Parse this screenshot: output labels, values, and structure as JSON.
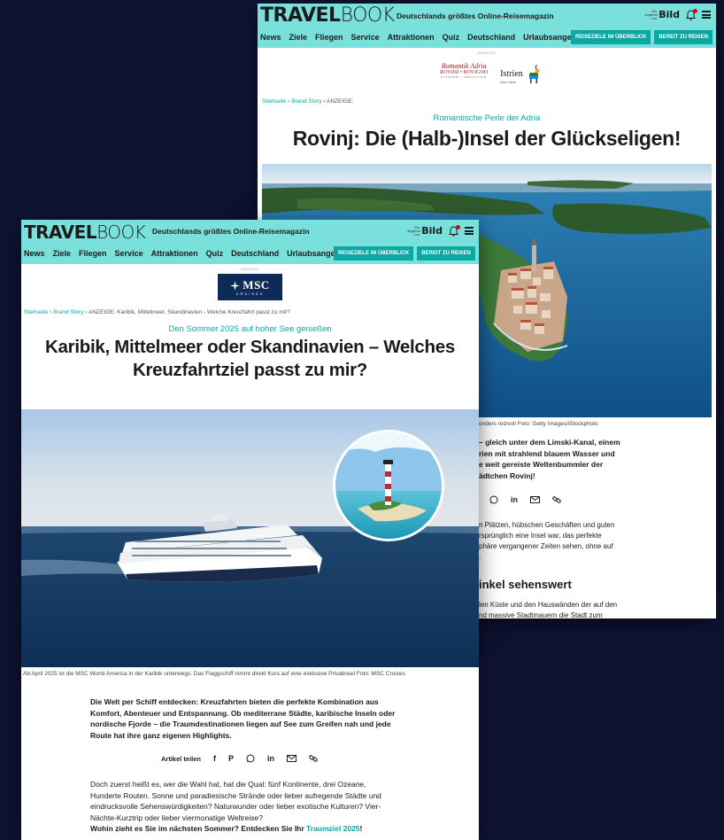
{
  "site": {
    "logo_bold": "TRAVEL",
    "logo_thin": "BOOK",
    "tagline": "Deutschlands größtes Online-Reisemagazin",
    "bild_mini": "Ein Angebot von",
    "bild_logo": "Bild",
    "nav": [
      "News",
      "Ziele",
      "Fliegen",
      "Service",
      "Attraktionen",
      "Quiz",
      "Deutschland",
      "Urlaubsangebote"
    ],
    "nav_buttons": [
      "REISEZIELE IM ÜBERBLICK",
      "BEREIT ZU REISEN"
    ],
    "ad_label": "ANZEIGE"
  },
  "back_article": {
    "ad_logo_script": "Romantik Adria",
    "ad_logo_name": "ROVINJ • ROVIGNO",
    "ad_logo_sub": "ISTRIEN • KROATIEN",
    "ad_logo_istrien": "Istrien",
    "ad_logo_istrien_sub": "Istra / Istria",
    "breadcrumb_home": "Startseite",
    "breadcrumb_section": "Brand Story",
    "breadcrumb_current": "ANZEIGE:",
    "kicker": "Romantische Perle der Adria",
    "title": "Rovinj: Die (Halb-)Insel der Glückseligen!",
    "caption": "onders reizvoll Foto: Getty Images/iStockphoto",
    "lead_lines": [
      "– gleich unter dem Limski-Kanal, einem",
      "rien mit strahlend blauem Wasser und",
      "e weit gereiste Weltenbummler der",
      "ädtchen Rovinj!"
    ],
    "body_lines": [
      "n Plätzen, hübschen Geschäften und guten",
      "rsprünglich eine Insel war, das perfekte",
      "phäre vergangener Zeiten sehen, ohne auf",
      "."
    ],
    "subheading": "inkel sehenswert",
    "body2_lines": [
      "len Küste und den Hauswänden der auf den",
      "nd massive Stadtmauern die Stadt zum"
    ]
  },
  "front_article": {
    "ad_logo": "MSC",
    "ad_logo_sub": "CRUISES",
    "breadcrumb_home": "Startseite",
    "breadcrumb_section": "Brand Story",
    "breadcrumb_current": "ANZEIGE: Karibik, Mittelmeer, Skandinavien - Welche Kreuzfahrt passt zu mir?",
    "kicker": "Den Sommer 2025 auf hoher See genießen",
    "title_line1": "Karibik, Mittelmeer oder Skandinavien – Welches",
    "title_line2": "Kreuzfahrtziel passt zu mir?",
    "caption": "Ab April 2025 ist die MSC World America in der Karibik unterwegs. Das Flaggschiff nimmt direkt Kurs auf eine exklusive Privatinsel Foto: MSC Cruises",
    "lead_lines": [
      "Die Welt per Schiff entdecken: Kreuzfahrten bieten die perfekte Kombination aus",
      "Komfort, Abenteuer und Entspannung. Ob mediterrane Städte, karibische Inseln oder",
      "nordische Fjorde – die Traumdestinationen liegen auf See zum Greifen nah und jede",
      "Route hat ihre ganz eigenen Highlights."
    ],
    "share_label": "Artikel teilen",
    "body_lines": [
      "Doch zuerst heißt es, wer die Wahl hat, hat die Qual: fünf Kontinente, drei Ozeane,",
      "Hunderte Routen. Sonne und paradiesische Strände oder lieber aufregende Städte und",
      "eindrucksvolle Sehenswürdigkeiten? Naturwunder oder lieber exotische Kulturen? Vier-",
      "Nächte-Kurztrip oder lieber viermonatige Weltreise?"
    ],
    "body_last_bold": "Wohin zieht es Sie im nächsten Sommer? Entdecken Sie Ihr ",
    "body_last_link": "Traumziel 2025",
    "body_last_end": "!"
  },
  "icons": {
    "share": [
      "facebook-icon",
      "pinterest-icon",
      "whatsapp-icon",
      "linkedin-icon",
      "mail-icon",
      "link-icon"
    ]
  },
  "colors": {
    "background": "#0f1333",
    "header": "#7ae0dc",
    "accent": "#0ba7a3",
    "text": "#1b1b1b"
  }
}
